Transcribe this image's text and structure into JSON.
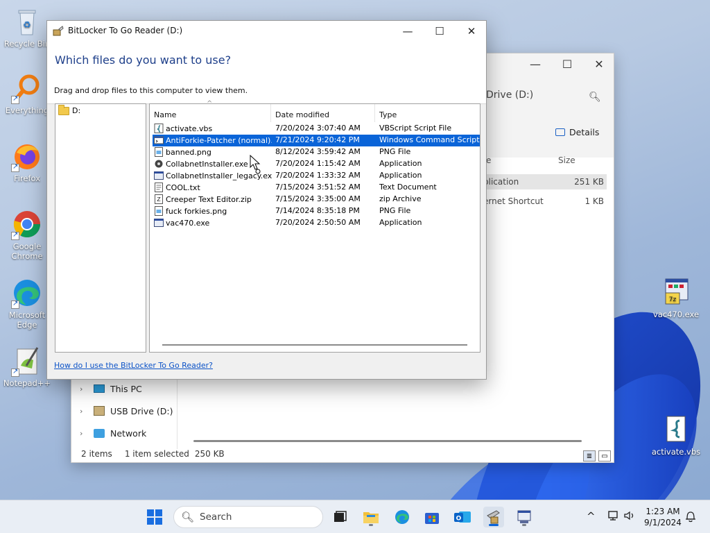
{
  "desktop": {
    "icons": [
      {
        "label": "Recycle Bin"
      },
      {
        "label": "Everything"
      },
      {
        "label": "Firefox"
      },
      {
        "label": "Google Chrome"
      },
      {
        "label": "Microsoft Edge"
      },
      {
        "label": "Notepad++"
      },
      {
        "label": "vac470.exe"
      },
      {
        "label": "activate.vbs"
      }
    ]
  },
  "explorer": {
    "address_fragment": "Drive (D:)",
    "details_label": "Details",
    "columns": {
      "type_fragment": "e",
      "size": "Size"
    },
    "rows": [
      {
        "type_fragment": "plication",
        "size": "251 KB"
      },
      {
        "type_fragment": "ernet Shortcut",
        "size": "1 KB"
      }
    ],
    "nav": [
      {
        "label": "This PC"
      },
      {
        "label": "USB Drive (D:)"
      },
      {
        "label": "Network"
      }
    ],
    "status": {
      "items": "2 items",
      "selected": "1 item selected",
      "size": "250 KB"
    }
  },
  "dialog": {
    "title": "BitLocker To Go Reader (D:)",
    "heading": "Which files do you want to use?",
    "instruction": "Drag and drop files to this computer to view them.",
    "tree_root": "D:",
    "columns": {
      "name": "Name",
      "date": "Date modified",
      "type": "Type"
    },
    "files": [
      {
        "name": "activate.vbs",
        "date": "7/20/2024 3:07:40 AM",
        "type": "VBScript Script File",
        "icon": "vbs-script-icon"
      },
      {
        "name": "AntiForkie-Patcher (normal)....",
        "date": "7/21/2024 9:20:42 PM",
        "type": "Windows Command Script",
        "icon": "cmd-script-icon",
        "selected": true
      },
      {
        "name": "banned.png",
        "date": "8/12/2024 3:59:42 AM",
        "type": "PNG File",
        "icon": "png-file-icon"
      },
      {
        "name": "CollabnetInstaller.exe",
        "date": "7/20/2024 1:15:42 AM",
        "type": "Application",
        "icon": "installer-icon"
      },
      {
        "name": "CollabnetInstaller_legacy.exe",
        "date": "7/20/2024 1:33:32 AM",
        "type": "Application",
        "icon": "app-window-icon"
      },
      {
        "name": "COOL.txt",
        "date": "7/15/2024 3:51:52 AM",
        "type": "Text Document",
        "icon": "text-file-icon"
      },
      {
        "name": "Creeper Text Editor.zip",
        "date": "7/15/2024 3:35:00 AM",
        "type": "zip Archive",
        "icon": "zip-file-icon"
      },
      {
        "name": "fuck forkies.png",
        "date": "7/14/2024 8:35:18 PM",
        "type": "PNG File",
        "icon": "png-file-icon"
      },
      {
        "name": "vac470.exe",
        "date": "7/20/2024 2:50:50 AM",
        "type": "Application",
        "icon": "app-window-icon"
      }
    ],
    "help_link": "How do I use the BitLocker To Go Reader?"
  },
  "taskbar": {
    "search_placeholder": "Search",
    "time": "1:23 AM",
    "date": "9/1/2024"
  },
  "colors": {
    "accent": "#0a64d8",
    "heading": "#1e3f8a",
    "link": "#0b52c7"
  }
}
